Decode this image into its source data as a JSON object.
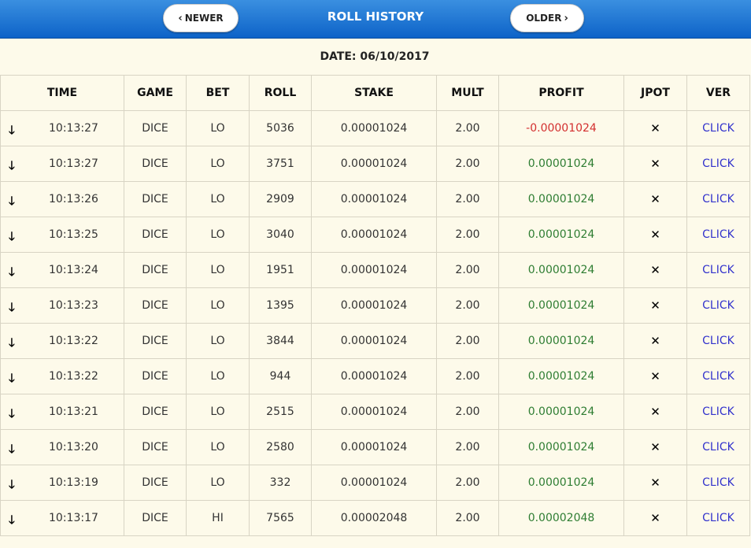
{
  "header": {
    "title": "ROLL HISTORY",
    "newer_label": "NEWER",
    "older_label": "OLDER"
  },
  "date_label": "DATE: 06/10/2017",
  "columns": [
    "TIME",
    "GAME",
    "BET",
    "ROLL",
    "STAKE",
    "MULT",
    "PROFIT",
    "JPOT",
    "VER"
  ],
  "rows": [
    {
      "direction_icon": "arrow-down-icon",
      "time": "10:13:27",
      "game": "DICE",
      "bet": "LO",
      "roll": "5036",
      "stake": "0.00001024",
      "mult": "2.00",
      "profit": "-0.00001024",
      "win": false,
      "jpot": "✕",
      "ver": "CLICK"
    },
    {
      "direction_icon": "arrow-down-icon",
      "time": "10:13:27",
      "game": "DICE",
      "bet": "LO",
      "roll": "3751",
      "stake": "0.00001024",
      "mult": "2.00",
      "profit": "0.00001024",
      "win": true,
      "jpot": "✕",
      "ver": "CLICK"
    },
    {
      "direction_icon": "arrow-down-icon",
      "time": "10:13:26",
      "game": "DICE",
      "bet": "LO",
      "roll": "2909",
      "stake": "0.00001024",
      "mult": "2.00",
      "profit": "0.00001024",
      "win": true,
      "jpot": "✕",
      "ver": "CLICK"
    },
    {
      "direction_icon": "arrow-down-icon",
      "time": "10:13:25",
      "game": "DICE",
      "bet": "LO",
      "roll": "3040",
      "stake": "0.00001024",
      "mult": "2.00",
      "profit": "0.00001024",
      "win": true,
      "jpot": "✕",
      "ver": "CLICK"
    },
    {
      "direction_icon": "arrow-down-icon",
      "time": "10:13:24",
      "game": "DICE",
      "bet": "LO",
      "roll": "1951",
      "stake": "0.00001024",
      "mult": "2.00",
      "profit": "0.00001024",
      "win": true,
      "jpot": "✕",
      "ver": "CLICK"
    },
    {
      "direction_icon": "arrow-down-icon",
      "time": "10:13:23",
      "game": "DICE",
      "bet": "LO",
      "roll": "1395",
      "stake": "0.00001024",
      "mult": "2.00",
      "profit": "0.00001024",
      "win": true,
      "jpot": "✕",
      "ver": "CLICK"
    },
    {
      "direction_icon": "arrow-down-icon",
      "time": "10:13:22",
      "game": "DICE",
      "bet": "LO",
      "roll": "3844",
      "stake": "0.00001024",
      "mult": "2.00",
      "profit": "0.00001024",
      "win": true,
      "jpot": "✕",
      "ver": "CLICK"
    },
    {
      "direction_icon": "arrow-down-icon",
      "time": "10:13:22",
      "game": "DICE",
      "bet": "LO",
      "roll": "944",
      "stake": "0.00001024",
      "mult": "2.00",
      "profit": "0.00001024",
      "win": true,
      "jpot": "✕",
      "ver": "CLICK"
    },
    {
      "direction_icon": "arrow-down-icon",
      "time": "10:13:21",
      "game": "DICE",
      "bet": "LO",
      "roll": "2515",
      "stake": "0.00001024",
      "mult": "2.00",
      "profit": "0.00001024",
      "win": true,
      "jpot": "✕",
      "ver": "CLICK"
    },
    {
      "direction_icon": "arrow-down-icon",
      "time": "10:13:20",
      "game": "DICE",
      "bet": "LO",
      "roll": "2580",
      "stake": "0.00001024",
      "mult": "2.00",
      "profit": "0.00001024",
      "win": true,
      "jpot": "✕",
      "ver": "CLICK"
    },
    {
      "direction_icon": "arrow-down-icon",
      "time": "10:13:19",
      "game": "DICE",
      "bet": "LO",
      "roll": "332",
      "stake": "0.00001024",
      "mult": "2.00",
      "profit": "0.00001024",
      "win": true,
      "jpot": "✕",
      "ver": "CLICK"
    },
    {
      "direction_icon": "arrow-down-icon",
      "time": "10:13:17",
      "game": "DICE",
      "bet": "HI",
      "roll": "7565",
      "stake": "0.00002048",
      "mult": "2.00",
      "profit": "0.00002048",
      "win": true,
      "jpot": "✕",
      "ver": "CLICK"
    }
  ],
  "colors": {
    "header_bar": "#0d63c8",
    "background": "#fdfaea",
    "profit_positive": "#2e7d32",
    "profit_negative": "#d32f2f",
    "link": "#3333cc"
  }
}
